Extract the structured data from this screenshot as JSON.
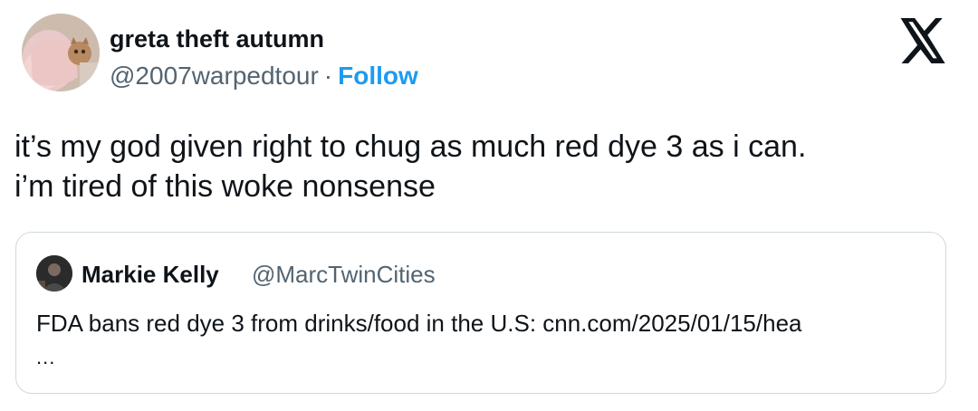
{
  "author": {
    "display_name": "greta theft autumn",
    "handle": "@2007warpedtour",
    "separator": "·",
    "follow_label": "Follow",
    "avatar_icon": "avatar-photo-icon"
  },
  "brand": {
    "logo_icon": "x-logo-icon"
  },
  "tweet": {
    "lines": [
      "it’s my god given right to chug as much red dye 3 as i can.",
      "i’m tired of this woke nonsense"
    ]
  },
  "quote": {
    "display_name": "Markie Kelly",
    "handle": "@MarcTwinCities",
    "text": "FDA bans red dye 3 from drinks/food in the U.S: cnn.com/2025/01/15/hea",
    "ellipsis": "..."
  },
  "colors": {
    "link": "#1d9bf0",
    "text": "#0f1419",
    "secondary": "#536471",
    "border": "#cfd9de"
  }
}
